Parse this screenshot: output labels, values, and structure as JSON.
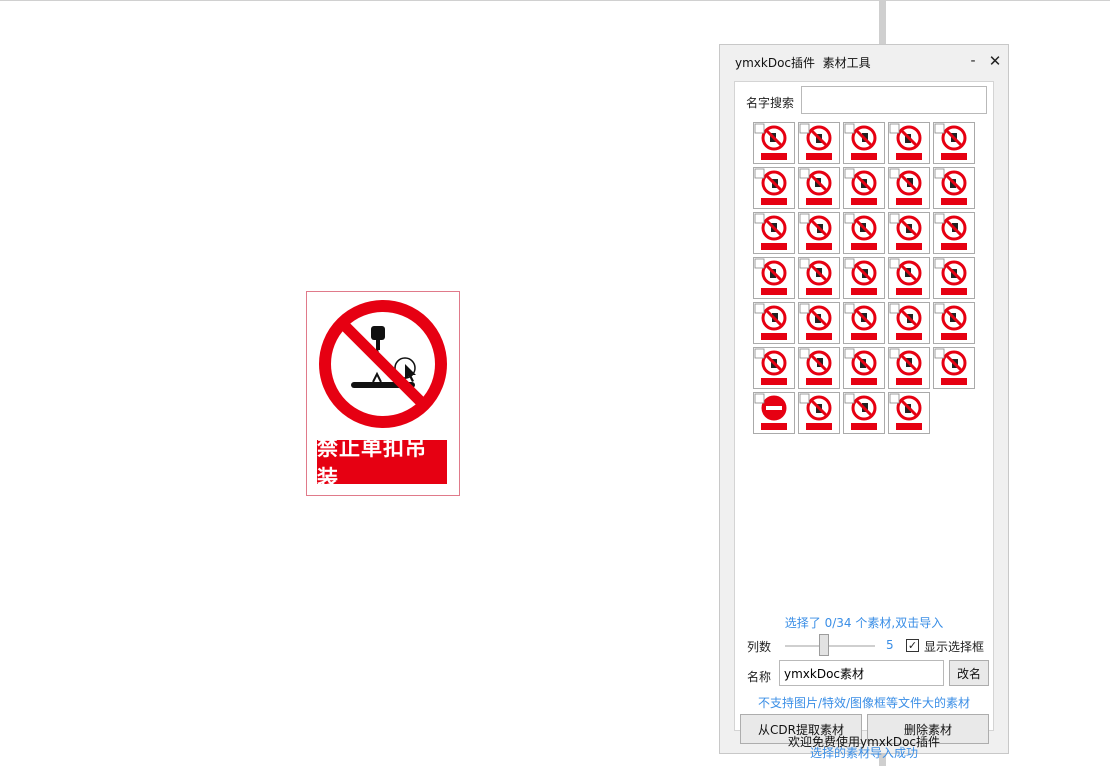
{
  "canvas_sign": {
    "caption": "禁止单扣吊装"
  },
  "panel": {
    "title": "ymxkDoc插件  素材工具",
    "minimize_symbol": "-",
    "close_symbol": "✕",
    "search": {
      "label": "名字搜索",
      "value": ""
    },
    "tiles_count": 34,
    "tile_sample_captions": [
      "禁止单扣吊装",
      "禁止吸烟",
      "禁止烟火",
      "禁止驶入",
      "禁止入内",
      "禁止攀登"
    ],
    "status_selected": "选择了 0/34 个素材,双击导入",
    "columns": {
      "label": "列数",
      "value": "5",
      "level": 5
    },
    "show_select_box": {
      "label": "显示选择框",
      "checked": true,
      "check_mark": "✓"
    },
    "name": {
      "label": "名称",
      "value": "ymxkDoc素材"
    },
    "rename_label": "改名",
    "warning": "不支持图片/特效/图像框等文件大的素材",
    "extract_label": "从CDR提取素材",
    "delete_label": "删除素材",
    "status_import": "选择的素材导入成功",
    "footer": "欢迎免费使用ymxkDoc插件"
  },
  "colors": {
    "sign_red": "#e60012",
    "accent_blue": "#3a8ee6"
  },
  "icons": {
    "minimize": "minimize-icon",
    "close": "close-icon",
    "check": "check-icon"
  }
}
